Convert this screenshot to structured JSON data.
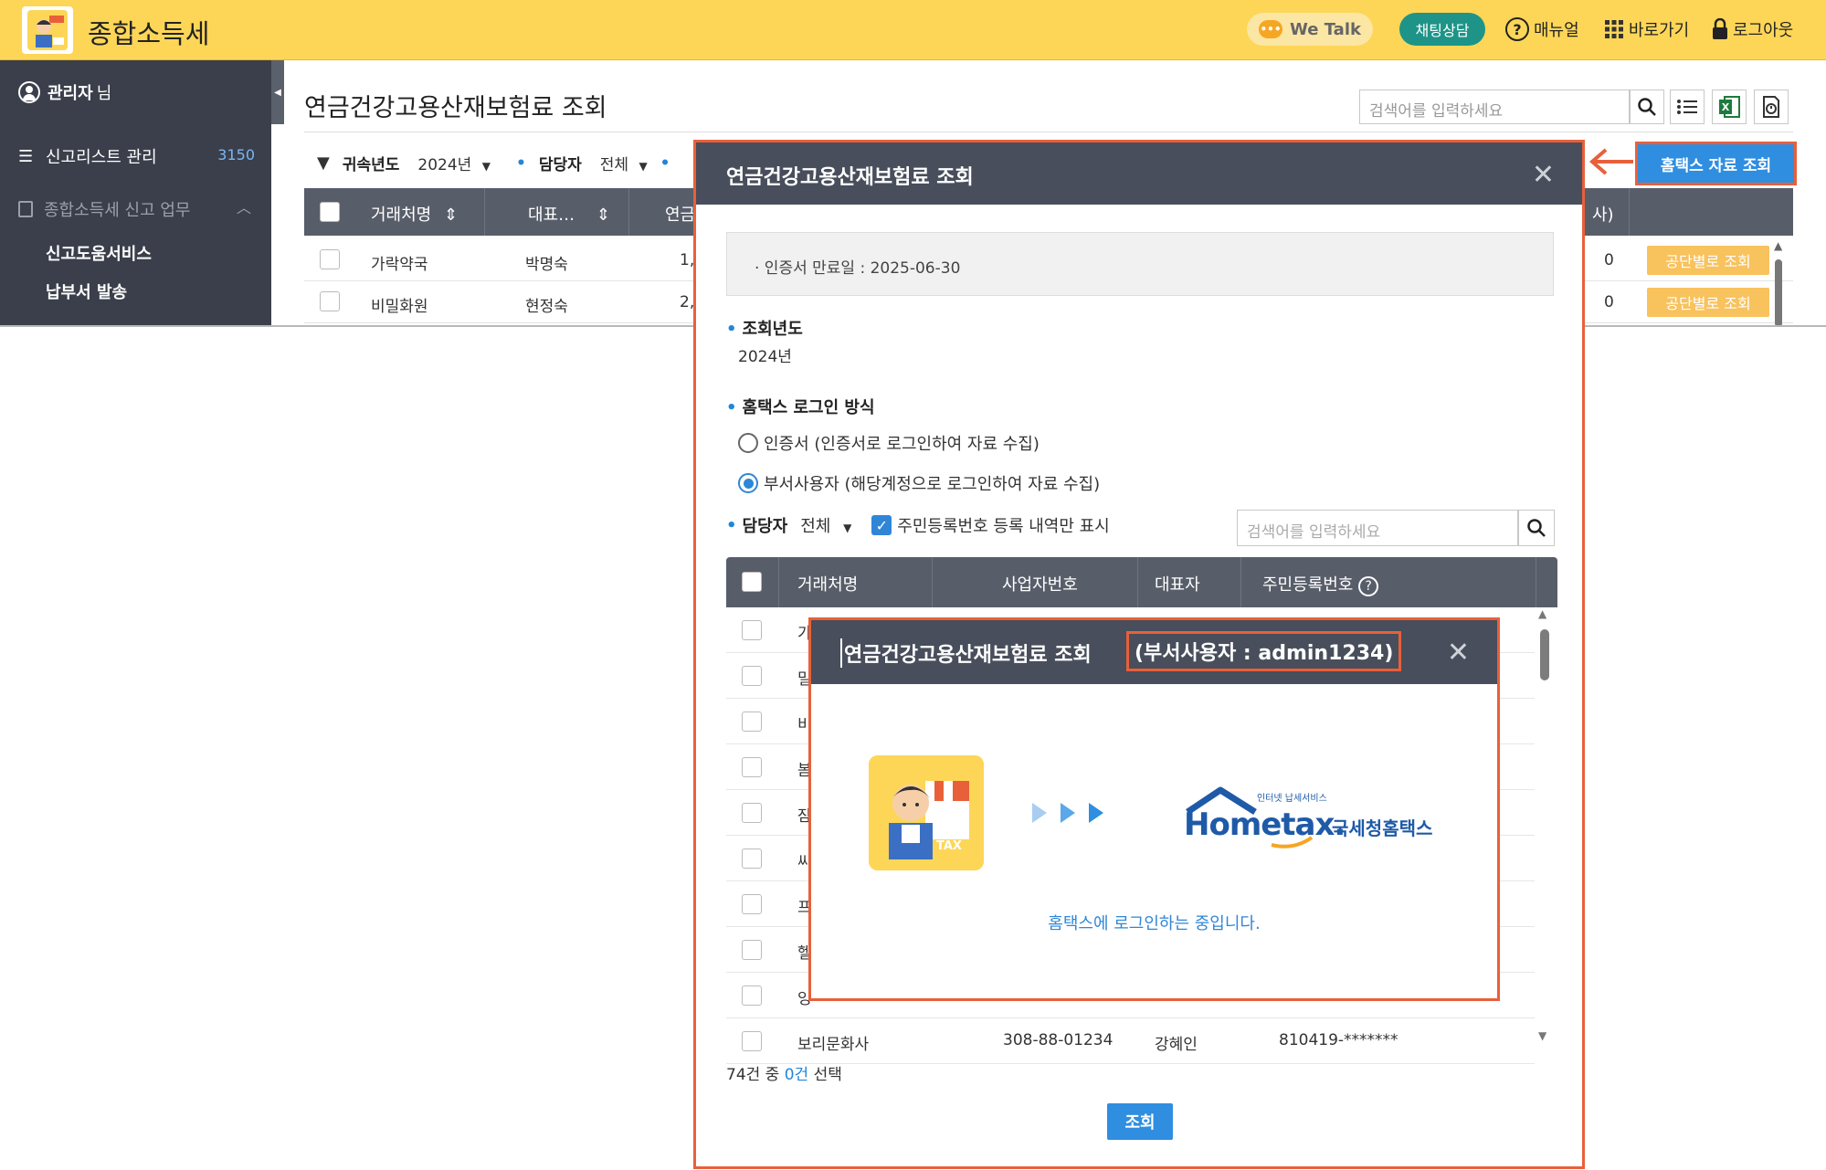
{
  "app": {
    "title": "종합소득세",
    "header": {
      "wetalk": "We Talk",
      "chat": "채팅상담",
      "manual": "매뉴얼",
      "shortcut": "바로가기",
      "logout": "로그아웃"
    }
  },
  "sidebar": {
    "admin_name": "관리자",
    "admin_suffix": "님",
    "list_label": "신고리스트 관리",
    "list_count": "3150",
    "group_label": "종합소득세 신고 업무",
    "sub_items": [
      "신고도움서비스",
      "납부서 발송"
    ]
  },
  "main": {
    "page_title": "연금건강고용산재보험료 조회",
    "search_placeholder": "검색어를 입력하세요",
    "filters": {
      "year_label": "귀속년도",
      "year_value": "2024년",
      "manager_label": "담당자",
      "manager_value": "전체"
    },
    "grid": {
      "headers": [
        "거래처명",
        "대표…",
        "연금",
        "사)"
      ],
      "rows": [
        {
          "name": "가락약국",
          "rep": "박명숙",
          "partial": "1,",
          "count": "0",
          "action": "공단별로 조회"
        },
        {
          "name": "비밀화원",
          "rep": "현정숙",
          "partial": "2,",
          "count": "0",
          "action": "공단별로 조회"
        }
      ]
    },
    "hometax_button": "홈택스 자료 조회"
  },
  "dialog": {
    "title": "연금건강고용산재보험료 조회",
    "cert_expiry": "· 인증서 만료일 : 2025-06-30",
    "year_section": "조회년도",
    "year_value": "2024년",
    "login_section": "홈택스 로그인 방식",
    "login_options": [
      {
        "label": "인증서 (인증서로 로그인하여 자료 수집)",
        "selected": false
      },
      {
        "label": "부서사용자 (해당계정으로 로그인하여 자료 수집)",
        "selected": true
      }
    ],
    "manager_label": "담당자",
    "manager_value": "전체",
    "checkbox_label": "주민등록번호 등록 내역만 표시",
    "checkbox_checked": true,
    "search_placeholder": "검색어를 입력하세요",
    "grid_headers": [
      "거래처명",
      "사업자번호",
      "대표자",
      "주민등록번호"
    ],
    "grid_rows": [
      {
        "name": "가",
        "biz": "",
        "rep": "",
        "rrn": ""
      },
      {
        "name": "밀",
        "biz": "",
        "rep": "",
        "rrn": ""
      },
      {
        "name": "비",
        "biz": "",
        "rep": "",
        "rrn": ""
      },
      {
        "name": "봄",
        "biz": "",
        "rep": "",
        "rrn": ""
      },
      {
        "name": "잠",
        "biz": "",
        "rep": "",
        "rrn": ""
      },
      {
        "name": "씨",
        "biz": "",
        "rep": "",
        "rrn": ""
      },
      {
        "name": "프",
        "biz": "",
        "rep": "",
        "rrn": ""
      },
      {
        "name": "헬",
        "biz": "",
        "rep": "",
        "rrn": ""
      },
      {
        "name": "잉",
        "biz": "",
        "rep": "",
        "rrn": ""
      },
      {
        "name": "보리문화사",
        "biz": "308-88-01234",
        "rep": "강혜인",
        "rrn": "810419-*******"
      }
    ],
    "selection_prefix": "74건 중 ",
    "selection_count": "0건",
    "selection_suffix": " 선택",
    "query_button": "조회"
  },
  "popup": {
    "title": "연금건강고용산재보험료 조회",
    "user_label": "(부서사용자 : admin1234)",
    "hometax_small": "인터넷 납세서비스",
    "hometax_brand": "Hometax.",
    "hometax_korean": "국세청홈택스",
    "icon_text": "TAX",
    "status": "홈택스에 로그인하는 중입니다."
  },
  "colors": {
    "topbar": "#fdd657",
    "sidebar": "#3a3f4b",
    "accent_blue": "#2f8ee0",
    "highlight_orange": "#e8603a",
    "dialog_header": "#484e5b"
  }
}
